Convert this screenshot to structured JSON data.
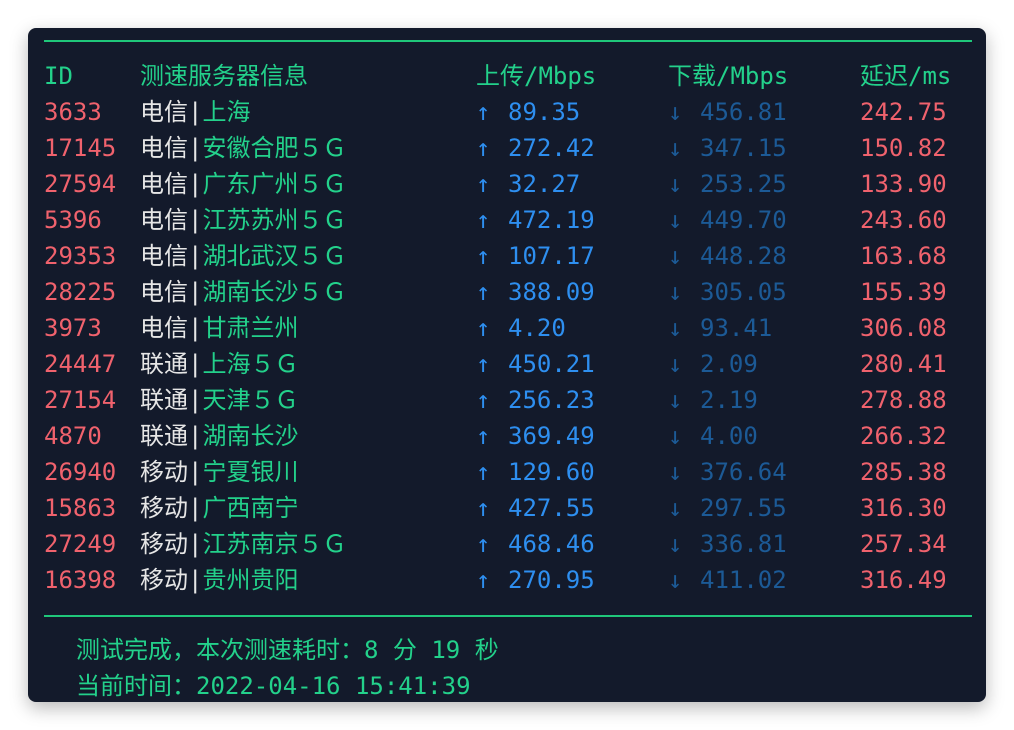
{
  "header": {
    "id": "ID",
    "server": "测速服务器信息",
    "upload": "上传/Mbps",
    "download": "下载/Mbps",
    "latency": "延迟/ms"
  },
  "rows": [
    {
      "id": "3633",
      "isp": "电信",
      "sep": "|",
      "location": "上海",
      "up_arrow": "↑",
      "upload": "89.35",
      "down_arrow": "↓",
      "download": "456.81",
      "latency": "242.75"
    },
    {
      "id": "17145",
      "isp": "电信",
      "sep": "|",
      "location": "安徽合肥５Ｇ",
      "up_arrow": "↑",
      "upload": "272.42",
      "down_arrow": "↓",
      "download": "347.15",
      "latency": "150.82"
    },
    {
      "id": "27594",
      "isp": "电信",
      "sep": "|",
      "location": "广东广州５Ｇ",
      "up_arrow": "↑",
      "upload": "32.27",
      "down_arrow": "↓",
      "download": "253.25",
      "latency": "133.90"
    },
    {
      "id": "5396",
      "isp": "电信",
      "sep": "|",
      "location": "江苏苏州５Ｇ",
      "up_arrow": "↑",
      "upload": "472.19",
      "down_arrow": "↓",
      "download": "449.70",
      "latency": "243.60"
    },
    {
      "id": "29353",
      "isp": "电信",
      "sep": "|",
      "location": "湖北武汉５Ｇ",
      "up_arrow": "↑",
      "upload": "107.17",
      "down_arrow": "↓",
      "download": "448.28",
      "latency": "163.68"
    },
    {
      "id": "28225",
      "isp": "电信",
      "sep": "|",
      "location": "湖南长沙５Ｇ",
      "up_arrow": "↑",
      "upload": "388.09",
      "down_arrow": "↓",
      "download": "305.05",
      "latency": "155.39"
    },
    {
      "id": "3973",
      "isp": "电信",
      "sep": "|",
      "location": "甘肃兰州",
      "up_arrow": "↑",
      "upload": "4.20",
      "down_arrow": "↓",
      "download": "93.41",
      "latency": "306.08"
    },
    {
      "id": "24447",
      "isp": "联通",
      "sep": "|",
      "location": "上海５Ｇ",
      "up_arrow": "↑",
      "upload": "450.21",
      "down_arrow": "↓",
      "download": "2.09",
      "latency": "280.41"
    },
    {
      "id": "27154",
      "isp": "联通",
      "sep": "|",
      "location": "天津５Ｇ",
      "up_arrow": "↑",
      "upload": "256.23",
      "down_arrow": "↓",
      "download": "2.19",
      "latency": "278.88"
    },
    {
      "id": "4870",
      "isp": "联通",
      "sep": "|",
      "location": "湖南长沙",
      "up_arrow": "↑",
      "upload": "369.49",
      "down_arrow": "↓",
      "download": "4.00",
      "latency": "266.32"
    },
    {
      "id": "26940",
      "isp": "移动",
      "sep": "|",
      "location": "宁夏银川",
      "up_arrow": "↑",
      "upload": "129.60",
      "down_arrow": "↓",
      "download": "376.64",
      "latency": "285.38"
    },
    {
      "id": "15863",
      "isp": "移动",
      "sep": "|",
      "location": "广西南宁",
      "up_arrow": "↑",
      "upload": "427.55",
      "down_arrow": "↓",
      "download": "297.55",
      "latency": "316.30"
    },
    {
      "id": "27249",
      "isp": "移动",
      "sep": "|",
      "location": "江苏南京５Ｇ",
      "up_arrow": "↑",
      "upload": "468.46",
      "down_arrow": "↓",
      "download": "336.81",
      "latency": "257.34"
    },
    {
      "id": "16398",
      "isp": "移动",
      "sep": "|",
      "location": "贵州贵阳",
      "up_arrow": "↑",
      "upload": "270.95",
      "down_arrow": "↓",
      "download": "411.02",
      "latency": "316.49"
    }
  ],
  "footer": {
    "line1": "测试完成，本次测速耗时：8 分 19 秒",
    "line2": "当前时间：2022-04-16 15:41:39"
  },
  "colors": {
    "background": "#131a2b",
    "rule": "#1fc77a",
    "header": "#23d18b",
    "id": "#f0626d",
    "isp": "#e6e6e6",
    "location": "#23d18b",
    "upload": "#2e8ff0",
    "download": "#1c5a96",
    "latency": "#f0626d"
  }
}
